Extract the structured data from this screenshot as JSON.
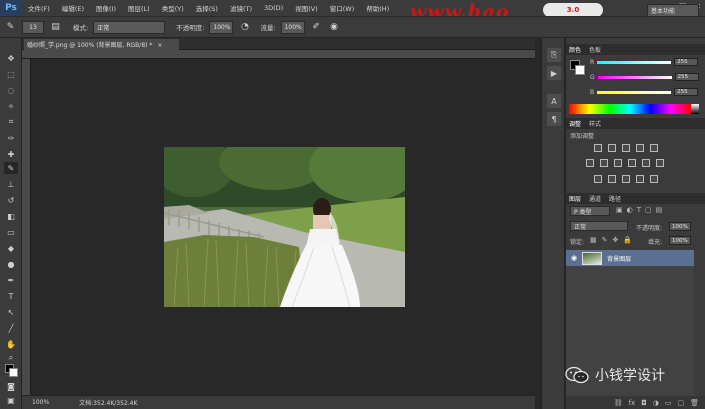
{
  "app": {
    "logo": "Ps"
  },
  "menu": [
    "文件(F)",
    "编辑(E)",
    "图像(I)",
    "图层(L)",
    "类型(Y)",
    "选择(S)",
    "滤镜(T)",
    "3D(D)",
    "视图(V)",
    "窗口(W)",
    "帮助(H)"
  ],
  "watermark_text": "www.hao",
  "badge_text": "3.0",
  "window_controls": [
    "—",
    "☐",
    "✕"
  ],
  "options": {
    "brush_size": "13",
    "mode_label": "模式:",
    "mode_value": "正常",
    "opacity_label": "不透明度:",
    "opacity_value": "100%",
    "flow_label": "流量:",
    "flow_value": "100%",
    "workspace": "基本功能"
  },
  "document": {
    "tab_title": "婚纱照_学.png @ 100% (背景图层, RGB/8) *",
    "tab_close": "×"
  },
  "status": {
    "zoom": "100%",
    "doc_size": "文档:352.4K/352.4K"
  },
  "color_panel": {
    "tabs": [
      "颜色",
      "色板"
    ],
    "channels": [
      {
        "label": "R",
        "value": "255",
        "color": "#ff5a5a"
      },
      {
        "label": "G",
        "value": "255",
        "color": "#5aff5a"
      },
      {
        "label": "B",
        "value": "255",
        "color": "#5a8cff"
      }
    ]
  },
  "adjust_panel": {
    "tabs": [
      "调整",
      "样式"
    ],
    "title": "添加调整"
  },
  "layers_panel": {
    "tabs": [
      "图层",
      "通道",
      "路径"
    ],
    "kind_label": "P 类型",
    "blend_mode": "正常",
    "opacity_label": "不透明度:",
    "opacity_value": "100%",
    "lock_label": "锁定:",
    "fill_label": "填充:",
    "fill_value": "100%",
    "layer_name": "背景图层"
  },
  "wechat_text": "小钱学设计"
}
